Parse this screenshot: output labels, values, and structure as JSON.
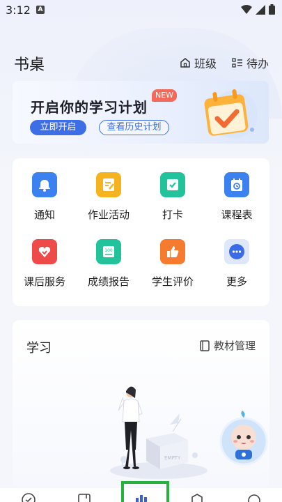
{
  "status": {
    "time": "3:12",
    "a_badge": "A"
  },
  "header": {
    "title": "书桌",
    "class_label": "班级",
    "todo_label": "待办"
  },
  "banner": {
    "title": "开启你的学习计划",
    "badge": "NEW",
    "start_label": "立即开启",
    "history_label": "查看历史计划"
  },
  "grid": {
    "items": [
      {
        "label": "通知",
        "icon": "bell-icon",
        "color": "#3b82f0"
      },
      {
        "label": "作业活动",
        "icon": "homework-icon",
        "color": "#f5b320"
      },
      {
        "label": "打卡",
        "icon": "checkin-icon",
        "color": "#22c39a"
      },
      {
        "label": "课程表",
        "icon": "calendar-icon",
        "color": "#3b82f0"
      },
      {
        "label": "课后服务",
        "icon": "after-school-icon",
        "color": "#ef4a4a"
      },
      {
        "label": "成绩报告",
        "icon": "report-icon",
        "color": "#22c39a"
      },
      {
        "label": "学生评价",
        "icon": "thumbs-up-icon",
        "color": "#f67b2e"
      },
      {
        "label": "更多",
        "icon": "more-icon",
        "color": "#3b82f0"
      }
    ]
  },
  "study": {
    "title": "学习",
    "manage_label": "教材管理"
  },
  "illustration": {
    "box_text": "EMPTY"
  }
}
